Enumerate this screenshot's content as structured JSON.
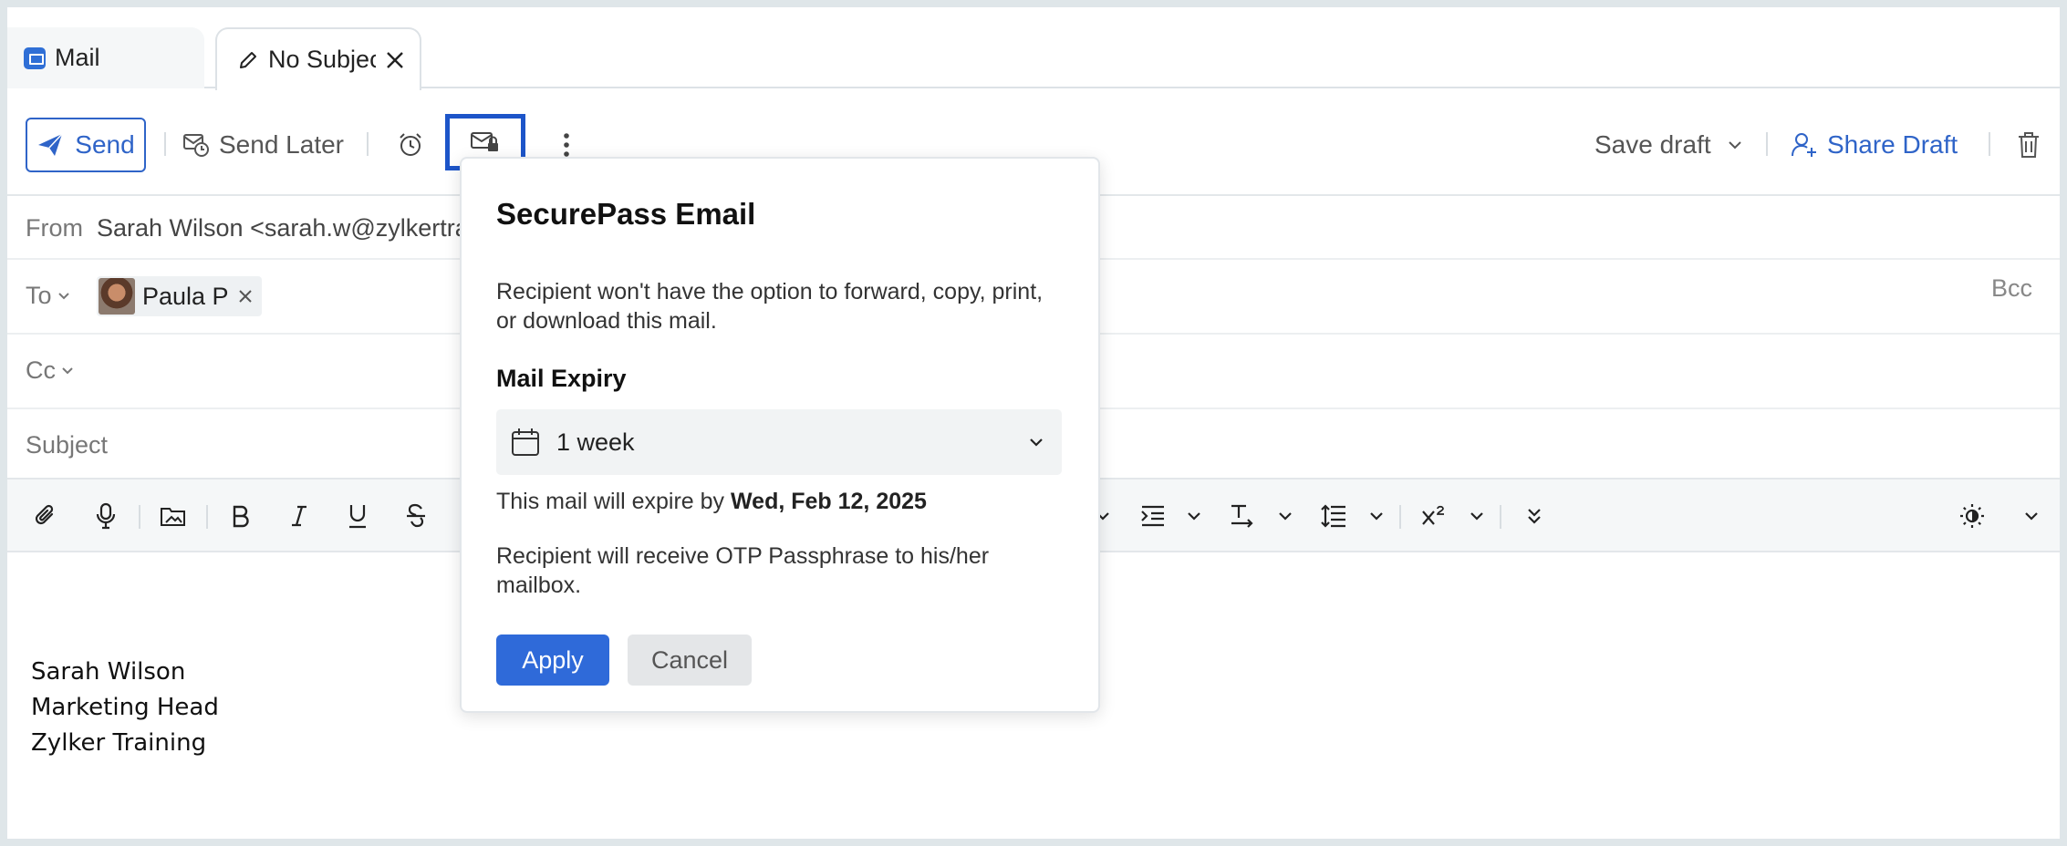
{
  "tabs": [
    {
      "label": "Mail",
      "icon": "mail-app-icon"
    },
    {
      "label": "No Subject",
      "icon": "pencil-icon"
    }
  ],
  "toolbar": {
    "send_label": "Send",
    "send_later_label": "Send Later",
    "save_draft_label": "Save draft",
    "share_draft_label": "Share Draft"
  },
  "fields": {
    "from_label": "From",
    "from_value": "Sarah Wilson <sarah.w@zylkertraining.com>",
    "to_label": "To",
    "to_recipient": "Paula P",
    "bcc_label": "Bcc",
    "cc_label": "Cc",
    "subject_label": "Subject"
  },
  "signature": [
    "Sarah Wilson",
    "Marketing Head",
    "Zylker Training"
  ],
  "popup": {
    "title": "SecurePass Email",
    "description": "Recipient won't have the option to forward, copy, print, or download this mail.",
    "expiry_label": "Mail Expiry",
    "expiry_value": "1 week",
    "expire_prefix": "This mail will expire by ",
    "expire_date": "Wed, Feb 12, 2025",
    "otp_text": "Recipient will receive OTP Passphrase to his/her mailbox.",
    "apply_label": "Apply",
    "cancel_label": "Cancel"
  },
  "colors": {
    "accent": "#2f64c8",
    "apply_bg": "#2f6ad9",
    "highlight_border": "#1d55c9"
  }
}
